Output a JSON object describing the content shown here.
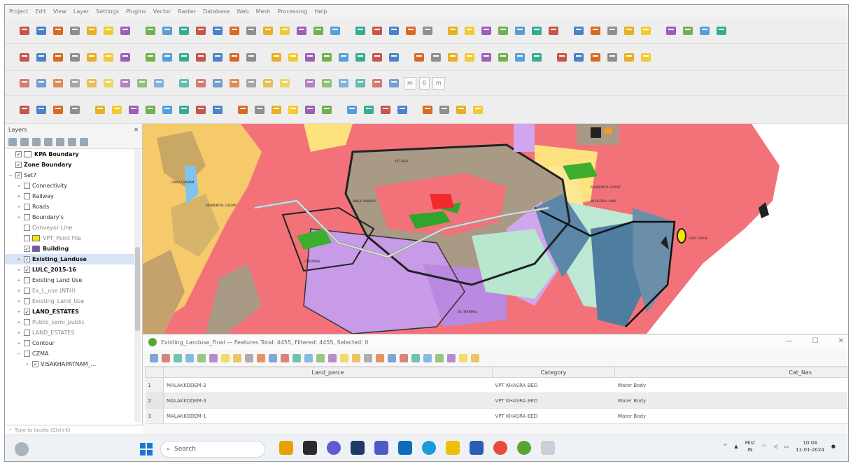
{
  "menubar": [
    "Project",
    "Edit",
    "View",
    "Layer",
    "Settings",
    "Plugins",
    "Vector",
    "Raster",
    "Database",
    "Web",
    "Mesh",
    "Processing",
    "Help"
  ],
  "toolbar3": {
    "field_unit": "m",
    "field_value": "0",
    "field_unit2": "m"
  },
  "layers_panel": {
    "title": "Layers",
    "items": [
      {
        "name": "KPA Boundary",
        "checked": true,
        "style": "bold",
        "swatch": "#ffffff",
        "expand": "",
        "indent": 0
      },
      {
        "name": "Zone Boundary",
        "checked": true,
        "style": "bold",
        "swatch": "",
        "expand": "",
        "indent": 0
      },
      {
        "name": "Set7",
        "checked": true,
        "style": "normal",
        "swatch": "",
        "expand": "−",
        "indent": 0
      },
      {
        "name": "Connectivity",
        "checked": false,
        "style": "normal",
        "swatch": "",
        "expand": "•",
        "indent": 1
      },
      {
        "name": "Railway",
        "checked": false,
        "style": "normal",
        "swatch": "",
        "expand": "•",
        "indent": 1
      },
      {
        "name": "Roads",
        "checked": false,
        "style": "normal",
        "swatch": "",
        "expand": "•",
        "indent": 1
      },
      {
        "name": "Boundary's",
        "checked": false,
        "style": "normal",
        "swatch": "",
        "expand": "•",
        "indent": 1
      },
      {
        "name": "Conveyor Line",
        "checked": false,
        "style": "dim",
        "swatch": "",
        "expand": "",
        "indent": 1
      },
      {
        "name": "VPT_Point File",
        "checked": false,
        "style": "dim",
        "swatch": "#f4e600",
        "expand": "",
        "indent": 1
      },
      {
        "name": "Building",
        "checked": true,
        "style": "bold",
        "swatch": "#7b4fc8",
        "expand": "",
        "indent": 1
      },
      {
        "name": "Existing_Landuse",
        "checked": true,
        "style": "bold",
        "swatch": "",
        "expand": "•",
        "indent": 1,
        "selected": true
      },
      {
        "name": "LULC_2015-16",
        "checked": true,
        "style": "bold",
        "swatch": "",
        "expand": "•",
        "indent": 1
      },
      {
        "name": "Existing Land Use",
        "checked": false,
        "style": "normal",
        "swatch": "",
        "expand": "•",
        "indent": 1
      },
      {
        "name": "Ex_L_use (NTH)",
        "checked": false,
        "style": "dim",
        "swatch": "",
        "expand": "•",
        "indent": 1
      },
      {
        "name": "Existing_Land_Use",
        "checked": false,
        "style": "dim",
        "swatch": "",
        "expand": "•",
        "indent": 1
      },
      {
        "name": "LAND_ESTATES",
        "checked": true,
        "style": "bold",
        "swatch": "",
        "expand": "•",
        "indent": 1
      },
      {
        "name": "Public_semi_public",
        "checked": false,
        "style": "dim",
        "swatch": "",
        "expand": "•",
        "indent": 1
      },
      {
        "name": "LAND_ESTATES",
        "checked": false,
        "style": "dim",
        "swatch": "",
        "expand": "•",
        "indent": 1
      },
      {
        "name": "Contour",
        "checked": false,
        "style": "normal",
        "swatch": "",
        "expand": "•",
        "indent": 1
      },
      {
        "name": "CZMA",
        "checked": false,
        "style": "normal",
        "swatch": "",
        "expand": "−",
        "indent": 1
      },
      {
        "name": "VISAKHAPATNAM_...",
        "checked": true,
        "style": "normal",
        "swatch": "",
        "expand": "•",
        "indent": 2
      }
    ],
    "locator_placeholder": "Type to locate (Ctrl+K)"
  },
  "attribute_table": {
    "title": "Existing_Landuse_Final — Features Total: 4455, Filtered: 4455, Selected: 0",
    "columns": [
      "Land_parce",
      "Category",
      "Cat_Nas"
    ],
    "rows": [
      {
        "n": "1",
        "land_parce": "MALAKKODEM-2",
        "category": "VPT KHASRA BED",
        "cat_nas": "Water Body"
      },
      {
        "n": "2",
        "land_parce": "MALAKKODEM-3",
        "category": "VPT KHASRA BED",
        "cat_nas": "Water Body"
      },
      {
        "n": "3",
        "land_parce": "MALAKKODEM-1",
        "category": "VPT KHASRA BED",
        "cat_nas": "Water Body"
      }
    ]
  },
  "taskbar": {
    "search_placeholder": "Search",
    "weather_line1": "Mist",
    "weather_line2": "IN",
    "time": "10:04",
    "date": "11-01-2024"
  },
  "colors": {
    "map_bg": "#f3727a",
    "qgis_green": "#5aa531",
    "windows_blue": "#1977d3"
  }
}
